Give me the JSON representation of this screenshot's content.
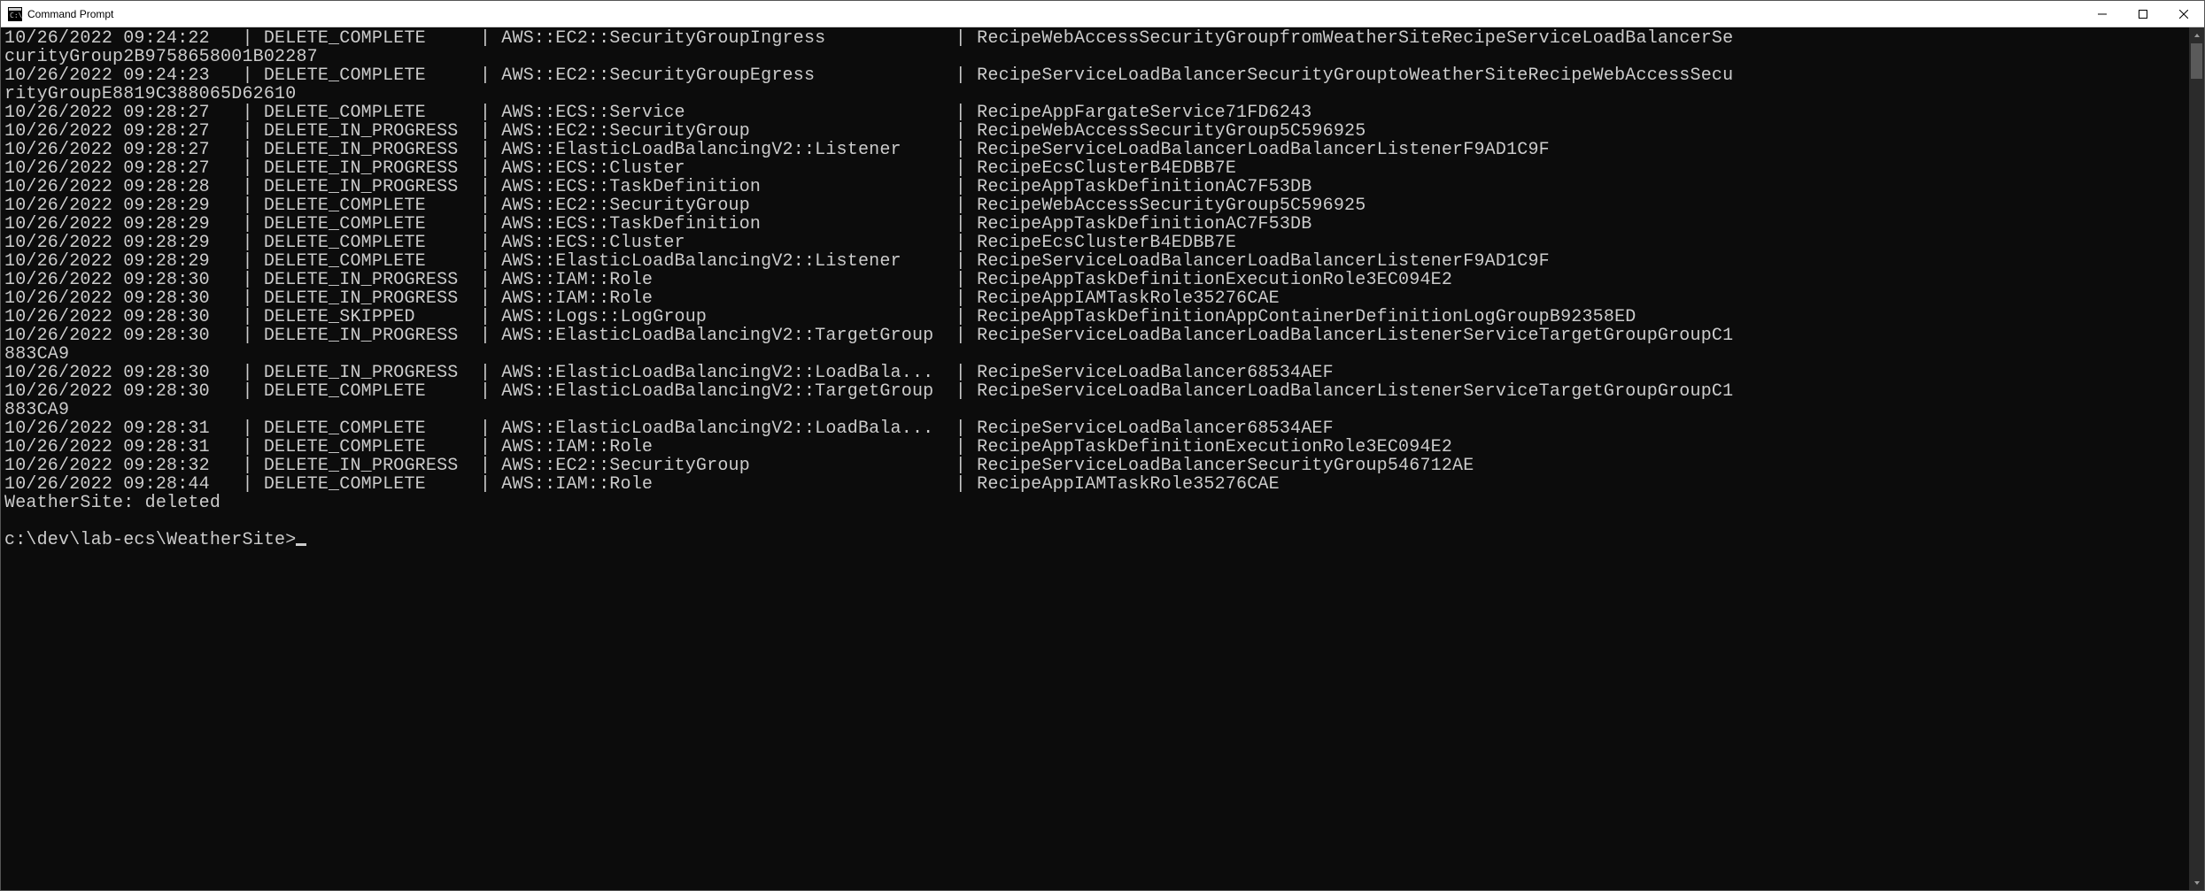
{
  "window": {
    "title": "Command Prompt"
  },
  "columns": {
    "c0": 0,
    "c1": 22,
    "c2": 44,
    "c3": 88
  },
  "sep": "|",
  "rows": [
    {
      "ts": "10/26/2022 09:24:22",
      "status": "DELETE_COMPLETE",
      "type": "AWS::EC2::SecurityGroupIngress",
      "id": "RecipeWebAccessSecurityGroupfromWeatherSiteRecipeServiceLoadBalancerSe",
      "wrap": "curityGroup2B9758658001B02287"
    },
    {
      "ts": "10/26/2022 09:24:23",
      "status": "DELETE_COMPLETE",
      "type": "AWS::EC2::SecurityGroupEgress",
      "id": "RecipeServiceLoadBalancerSecurityGrouptoWeatherSiteRecipeWebAccessSecu",
      "wrap": "rityGroupE8819C388065D62610"
    },
    {
      "ts": "10/26/2022 09:28:27",
      "status": "DELETE_COMPLETE",
      "type": "AWS::ECS::Service",
      "id": "RecipeAppFargateService71FD6243"
    },
    {
      "ts": "10/26/2022 09:28:27",
      "status": "DELETE_IN_PROGRESS",
      "type": "AWS::EC2::SecurityGroup",
      "id": "RecipeWebAccessSecurityGroup5C596925"
    },
    {
      "ts": "10/26/2022 09:28:27",
      "status": "DELETE_IN_PROGRESS",
      "type": "AWS::ElasticLoadBalancingV2::Listener",
      "id": "RecipeServiceLoadBalancerLoadBalancerListenerF9AD1C9F"
    },
    {
      "ts": "10/26/2022 09:28:27",
      "status": "DELETE_IN_PROGRESS",
      "type": "AWS::ECS::Cluster",
      "id": "RecipeEcsClusterB4EDBB7E"
    },
    {
      "ts": "10/26/2022 09:28:28",
      "status": "DELETE_IN_PROGRESS",
      "type": "AWS::ECS::TaskDefinition",
      "id": "RecipeAppTaskDefinitionAC7F53DB"
    },
    {
      "ts": "10/26/2022 09:28:29",
      "status": "DELETE_COMPLETE",
      "type": "AWS::EC2::SecurityGroup",
      "id": "RecipeWebAccessSecurityGroup5C596925"
    },
    {
      "ts": "10/26/2022 09:28:29",
      "status": "DELETE_COMPLETE",
      "type": "AWS::ECS::TaskDefinition",
      "id": "RecipeAppTaskDefinitionAC7F53DB"
    },
    {
      "ts": "10/26/2022 09:28:29",
      "status": "DELETE_COMPLETE",
      "type": "AWS::ECS::Cluster",
      "id": "RecipeEcsClusterB4EDBB7E"
    },
    {
      "ts": "10/26/2022 09:28:29",
      "status": "DELETE_COMPLETE",
      "type": "AWS::ElasticLoadBalancingV2::Listener",
      "id": "RecipeServiceLoadBalancerLoadBalancerListenerF9AD1C9F"
    },
    {
      "ts": "10/26/2022 09:28:30",
      "status": "DELETE_IN_PROGRESS",
      "type": "AWS::IAM::Role",
      "id": "RecipeAppTaskDefinitionExecutionRole3EC094E2"
    },
    {
      "ts": "10/26/2022 09:28:30",
      "status": "DELETE_IN_PROGRESS",
      "type": "AWS::IAM::Role",
      "id": "RecipeAppIAMTaskRole35276CAE"
    },
    {
      "ts": "10/26/2022 09:28:30",
      "status": "DELETE_SKIPPED",
      "type": "AWS::Logs::LogGroup",
      "id": "RecipeAppTaskDefinitionAppContainerDefinitionLogGroupB92358ED"
    },
    {
      "ts": "10/26/2022 09:28:30",
      "status": "DELETE_IN_PROGRESS",
      "type": "AWS::ElasticLoadBalancingV2::TargetGroup",
      "id": "RecipeServiceLoadBalancerLoadBalancerListenerServiceTargetGroupGroupC1",
      "wrap": "883CA9"
    },
    {
      "ts": "10/26/2022 09:28:30",
      "status": "DELETE_IN_PROGRESS",
      "type": "AWS::ElasticLoadBalancingV2::LoadBala...",
      "id": "RecipeServiceLoadBalancer68534AEF"
    },
    {
      "ts": "10/26/2022 09:28:30",
      "status": "DELETE_COMPLETE",
      "type": "AWS::ElasticLoadBalancingV2::TargetGroup",
      "id": "RecipeServiceLoadBalancerLoadBalancerListenerServiceTargetGroupGroupC1",
      "wrap": "883CA9"
    },
    {
      "ts": "10/26/2022 09:28:31",
      "status": "DELETE_COMPLETE",
      "type": "AWS::ElasticLoadBalancingV2::LoadBala...",
      "id": "RecipeServiceLoadBalancer68534AEF"
    },
    {
      "ts": "10/26/2022 09:28:31",
      "status": "DELETE_COMPLETE",
      "type": "AWS::IAM::Role",
      "id": "RecipeAppTaskDefinitionExecutionRole3EC094E2"
    },
    {
      "ts": "10/26/2022 09:28:32",
      "status": "DELETE_IN_PROGRESS",
      "type": "AWS::EC2::SecurityGroup",
      "id": "RecipeServiceLoadBalancerSecurityGroup546712AE"
    },
    {
      "ts": "10/26/2022 09:28:44",
      "status": "DELETE_COMPLETE",
      "type": "AWS::IAM::Role",
      "id": "RecipeAppIAMTaskRole35276CAE"
    }
  ],
  "status_line": "WeatherSite: deleted",
  "prompt": "c:\\dev\\lab-ecs\\WeatherSite>"
}
